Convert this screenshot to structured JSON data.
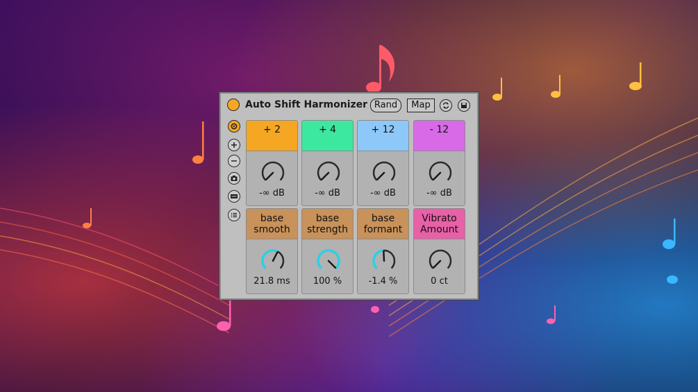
{
  "device": {
    "title": "Auto Shift Harmonizer",
    "rand_label": "Rand",
    "map_label": "Map"
  },
  "icons": {
    "power": "power-icon",
    "sync": "sync-icon",
    "save": "save-icon",
    "side": [
      "link-icon",
      "plus-icon",
      "minus-icon",
      "camera-icon",
      "keyboard-icon",
      "list-icon"
    ]
  },
  "voices": [
    {
      "label": "+ 2",
      "value": "-∞ dB",
      "color": "#f5a623",
      "level": 0.0
    },
    {
      "label": "+ 4",
      "value": "-∞ dB",
      "color": "#3ce8a0",
      "level": 0.0
    },
    {
      "label": "+ 12",
      "value": "-∞ dB",
      "color": "#8ec8f8",
      "level": 0.0
    },
    {
      "label": "- 12",
      "value": "-∞ dB",
      "color": "#d86ae8",
      "level": 0.0
    }
  ],
  "params": [
    {
      "label": "base\nsmooth",
      "value": "21.8 ms",
      "color": "#c8925a",
      "level": 0.6
    },
    {
      "label": "base\nstrength",
      "value": "100 %",
      "color": "#c8925a",
      "level": 1.0
    },
    {
      "label": "base\nformant",
      "value": "-1.4 %",
      "color": "#c8925a",
      "level": 0.49
    },
    {
      "label": "Vibrato\nAmount",
      "value": "0 ct",
      "color": "#e860a8",
      "level": 0.0
    }
  ],
  "colors": {
    "accent": "#f5a623",
    "knob_arc": "#2ad0e8",
    "panel": "#bfbfbf"
  }
}
